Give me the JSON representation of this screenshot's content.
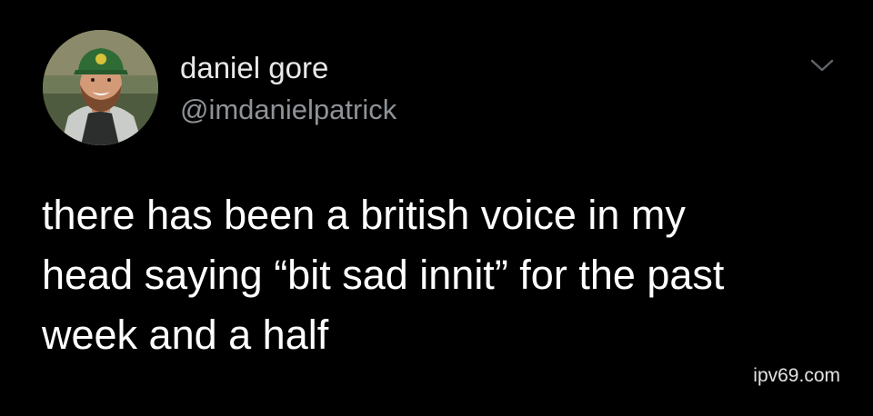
{
  "author": {
    "display_name": "daniel gore",
    "handle": "@imdanielpatrick"
  },
  "tweet": {
    "lines": [
      "there has been a british voice in my",
      "head saying “bit sad innit” for the past",
      "week and a half"
    ]
  },
  "watermark": "ipv69.com",
  "icons": {
    "more": "chevron-down-icon"
  },
  "colors": {
    "background": "#000000",
    "text": "#ffffff",
    "handle": "#8e9398"
  }
}
